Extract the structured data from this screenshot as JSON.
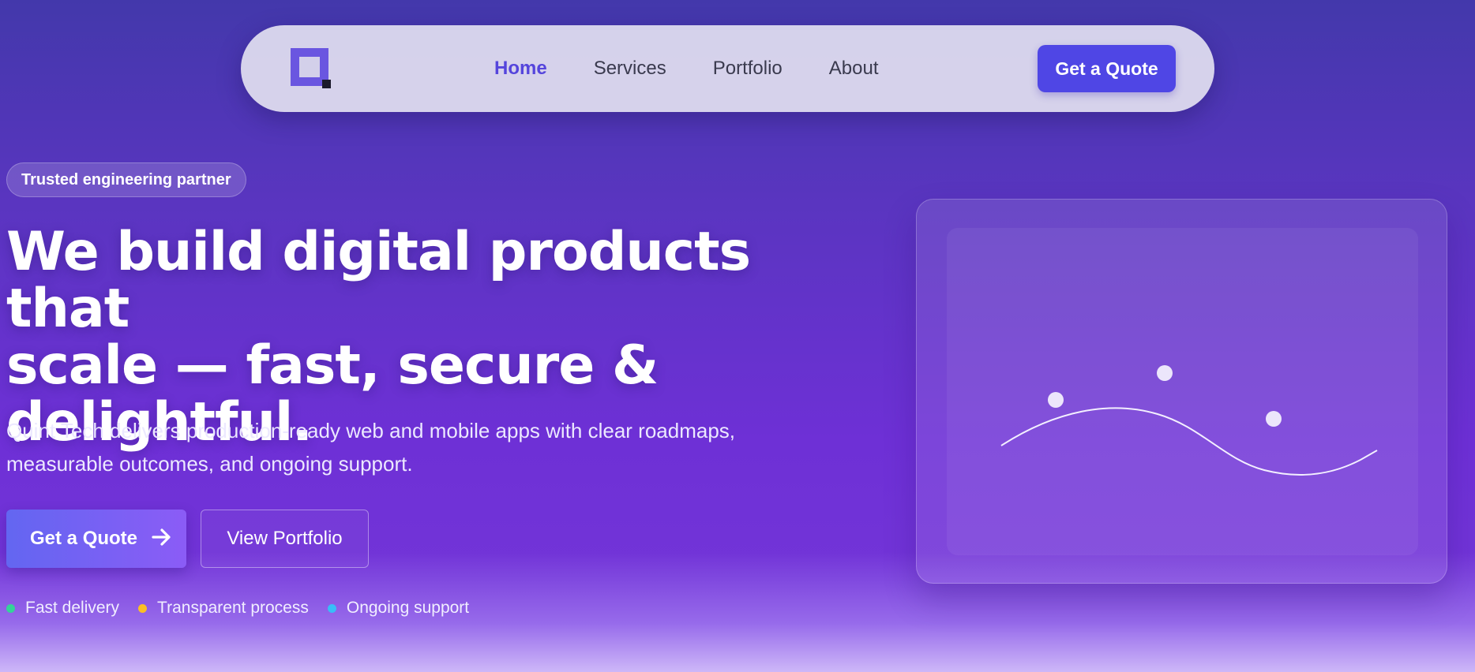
{
  "nav": {
    "logo_name": "quint-tech-logo",
    "links": [
      {
        "label": "Home",
        "active": true
      },
      {
        "label": "Services",
        "active": false
      },
      {
        "label": "Portfolio",
        "active": false
      },
      {
        "label": "About",
        "active": false
      }
    ],
    "cta_label": "Get a Quote"
  },
  "hero": {
    "badge": "Trusted engineering partner",
    "headline_lines": [
      "We build digital products that",
      "scale — fast, secure &",
      "delightful."
    ],
    "subtitle": "Quint Tech delivers production-ready web and mobile apps with clear roadmaps, measurable outcomes, and ongoing support.",
    "primary_cta": "Get a Quote",
    "primary_cta_icon": "arrow-right-icon",
    "secondary_cta": "View Portfolio",
    "features": [
      {
        "label": "Fast delivery",
        "color": "#34d399"
      },
      {
        "label": "Transparent process",
        "color": "#fbbf24"
      },
      {
        "label": "Ongoing support",
        "color": "#38bdf8"
      }
    ]
  },
  "illustration": {
    "description_icon": "wave-illustration-icon",
    "colors": {
      "line": "#f3efff",
      "dots": "#ece6fb"
    }
  }
}
